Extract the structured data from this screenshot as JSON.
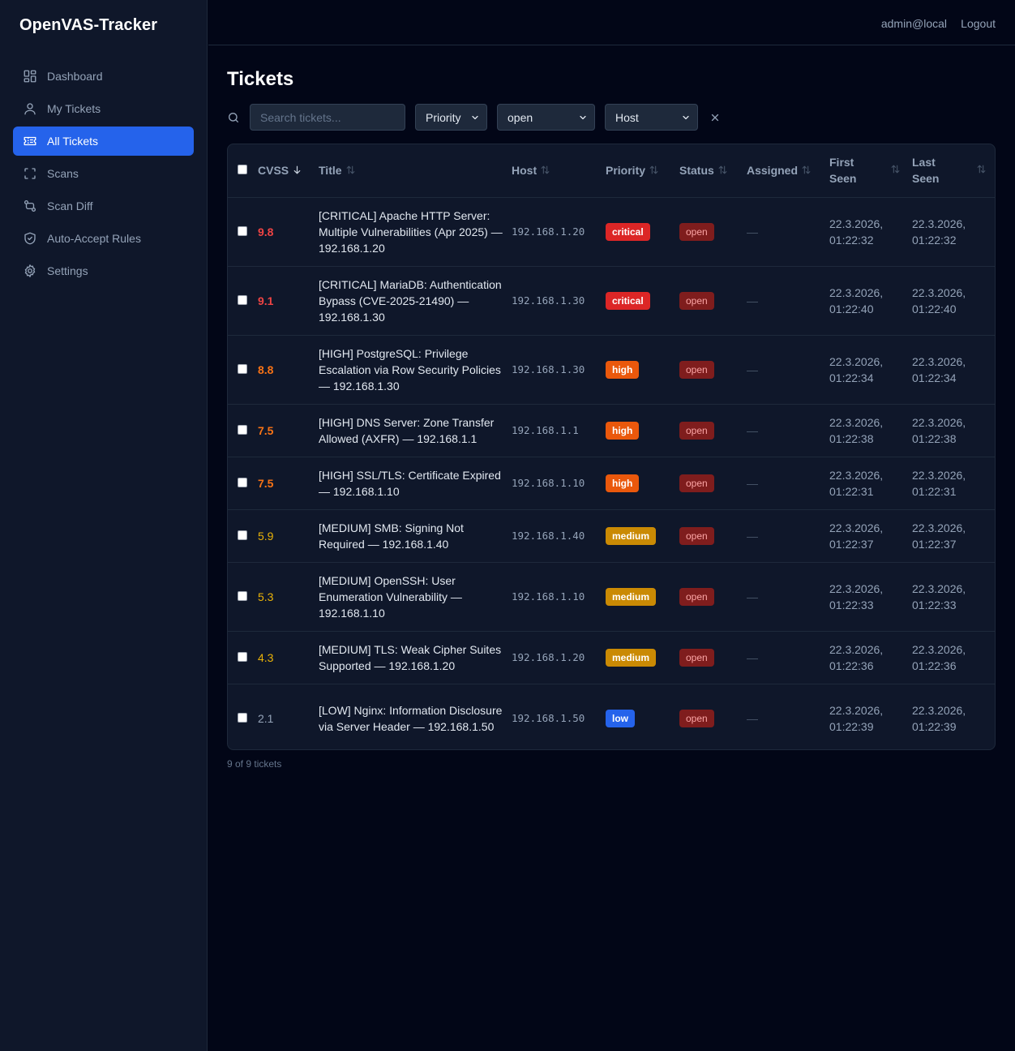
{
  "app": {
    "title": "OpenVAS-Tracker"
  },
  "nav": [
    {
      "label": "Dashboard",
      "icon": "dashboard-icon",
      "active": false
    },
    {
      "label": "My Tickets",
      "icon": "user-icon",
      "active": false
    },
    {
      "label": "All Tickets",
      "icon": "ticket-icon",
      "active": true
    },
    {
      "label": "Scans",
      "icon": "scan-icon",
      "active": false
    },
    {
      "label": "Scan Diff",
      "icon": "diff-icon",
      "active": false
    },
    {
      "label": "Auto-Accept Rules",
      "icon": "shield-icon",
      "active": false
    },
    {
      "label": "Settings",
      "icon": "gear-icon",
      "active": false
    }
  ],
  "topbar": {
    "user": "admin@local",
    "logout": "Logout"
  },
  "page": {
    "title": "Tickets"
  },
  "filters": {
    "search_placeholder": "Search tickets...",
    "search_value": "",
    "priority": "Priority",
    "status": "open",
    "host": "Host"
  },
  "table": {
    "columns": {
      "cvss": "CVSS",
      "title": "Title",
      "host": "Host",
      "priority": "Priority",
      "status": "Status",
      "assigned": "Assigned",
      "first_seen_1": "First",
      "first_seen_2": "Seen",
      "last_seen_1": "Last",
      "last_seen_2": "Seen"
    },
    "rows": [
      {
        "cvss": "9.8",
        "title": "[CRITICAL] Apache HTTP Server: Multiple Vulnerabilities (Apr 2025) — 192.168.1.20",
        "host": "192.168.1.20",
        "priority": "critical",
        "status": "open",
        "assigned": "—",
        "first_date": "22.3.2026,",
        "first_time": "01:22:32",
        "last_date": "22.3.2026,",
        "last_time": "01:22:32"
      },
      {
        "cvss": "9.1",
        "title": "[CRITICAL] MariaDB: Authentication Bypass (CVE-2025-21490) — 192.168.1.30",
        "host": "192.168.1.30",
        "priority": "critical",
        "status": "open",
        "assigned": "—",
        "first_date": "22.3.2026,",
        "first_time": "01:22:40",
        "last_date": "22.3.2026,",
        "last_time": "01:22:40"
      },
      {
        "cvss": "8.8",
        "title": "[HIGH] PostgreSQL: Privilege Escalation via Row Security Policies — 192.168.1.30",
        "host": "192.168.1.30",
        "priority": "high",
        "status": "open",
        "assigned": "—",
        "first_date": "22.3.2026,",
        "first_time": "01:22:34",
        "last_date": "22.3.2026,",
        "last_time": "01:22:34"
      },
      {
        "cvss": "7.5",
        "title": "[HIGH] DNS Server: Zone Transfer Allowed (AXFR) — 192.168.1.1",
        "host": "192.168.1.1",
        "priority": "high",
        "status": "open",
        "assigned": "—",
        "first_date": "22.3.2026,",
        "first_time": "01:22:38",
        "last_date": "22.3.2026,",
        "last_time": "01:22:38"
      },
      {
        "cvss": "7.5",
        "title": "[HIGH] SSL/TLS: Certificate Expired — 192.168.1.10",
        "host": "192.168.1.10",
        "priority": "high",
        "status": "open",
        "assigned": "—",
        "first_date": "22.3.2026,",
        "first_time": "01:22:31",
        "last_date": "22.3.2026,",
        "last_time": "01:22:31"
      },
      {
        "cvss": "5.9",
        "title": "[MEDIUM] SMB: Signing Not Required — 192.168.1.40",
        "host": "192.168.1.40",
        "priority": "medium",
        "status": "open",
        "assigned": "—",
        "first_date": "22.3.2026,",
        "first_time": "01:22:37",
        "last_date": "22.3.2026,",
        "last_time": "01:22:37"
      },
      {
        "cvss": "5.3",
        "title": "[MEDIUM] OpenSSH: User Enumeration Vulnerability — 192.168.1.10",
        "host": "192.168.1.10",
        "priority": "medium",
        "status": "open",
        "assigned": "—",
        "first_date": "22.3.2026,",
        "first_time": "01:22:33",
        "last_date": "22.3.2026,",
        "last_time": "01:22:33"
      },
      {
        "cvss": "4.3",
        "title": "[MEDIUM] TLS: Weak Cipher Suites Supported — 192.168.1.20",
        "host": "192.168.1.20",
        "priority": "medium",
        "status": "open",
        "assigned": "—",
        "first_date": "22.3.2026,",
        "first_time": "01:22:36",
        "last_date": "22.3.2026,",
        "last_time": "01:22:36"
      },
      {
        "cvss": "2.1",
        "title": "[LOW] Nginx: Information Disclosure via Server Header — 192.168.1.50",
        "host": "192.168.1.50",
        "priority": "low",
        "status": "open",
        "assigned": "—",
        "first_date": "22.3.2026,",
        "first_time": "01:22:39",
        "last_date": "22.3.2026,",
        "last_time": "01:22:39"
      }
    ]
  },
  "footer": {
    "count": "9 of 9 tickets"
  },
  "colors": {
    "accent": "#2563eb",
    "critical": "#dc2626",
    "high": "#ea580c",
    "medium": "#ca8a04",
    "low": "#2563eb",
    "status_open": "#7f1d1d"
  }
}
